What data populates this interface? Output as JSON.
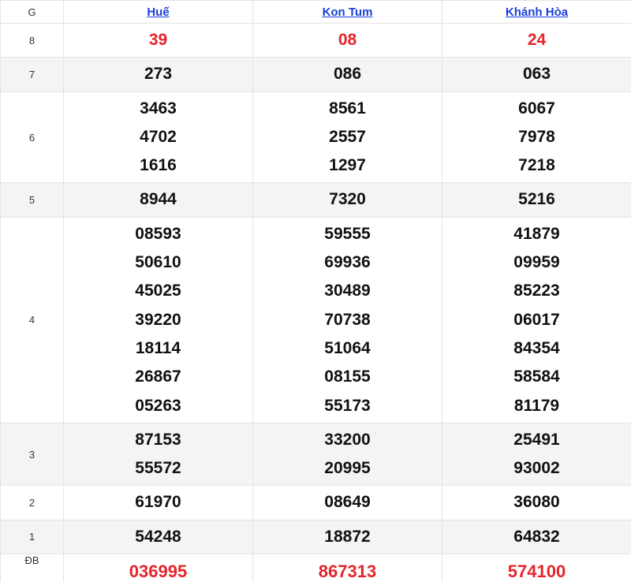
{
  "header": {
    "prize_col": "G",
    "provinces": [
      "Huế",
      "Kon Tum",
      "Khánh Hòa"
    ]
  },
  "rows": [
    {
      "prize": "8",
      "red": true,
      "alt": false,
      "values": [
        [
          "39"
        ],
        [
          "08"
        ],
        [
          "24"
        ]
      ]
    },
    {
      "prize": "7",
      "red": false,
      "alt": true,
      "values": [
        [
          "273"
        ],
        [
          "086"
        ],
        [
          "063"
        ]
      ]
    },
    {
      "prize": "6",
      "red": false,
      "alt": false,
      "values": [
        [
          "3463",
          "4702",
          "1616"
        ],
        [
          "8561",
          "2557",
          "1297"
        ],
        [
          "6067",
          "7978",
          "7218"
        ]
      ]
    },
    {
      "prize": "5",
      "red": false,
      "alt": true,
      "values": [
        [
          "8944"
        ],
        [
          "7320"
        ],
        [
          "5216"
        ]
      ]
    },
    {
      "prize": "4",
      "red": false,
      "alt": false,
      "values": [
        [
          "08593",
          "50610",
          "45025",
          "39220",
          "18114",
          "26867",
          "05263"
        ],
        [
          "59555",
          "69936",
          "30489",
          "70738",
          "51064",
          "08155",
          "55173"
        ],
        [
          "41879",
          "09959",
          "85223",
          "06017",
          "84354",
          "58584",
          "81179"
        ]
      ]
    },
    {
      "prize": "3",
      "red": false,
      "alt": true,
      "values": [
        [
          "87153",
          "55572"
        ],
        [
          "33200",
          "20995"
        ],
        [
          "25491",
          "93002"
        ]
      ]
    },
    {
      "prize": "2",
      "red": false,
      "alt": false,
      "values": [
        [
          "61970"
        ],
        [
          "08649"
        ],
        [
          "36080"
        ]
      ]
    },
    {
      "prize": "1",
      "red": false,
      "alt": true,
      "values": [
        [
          "54248"
        ],
        [
          "18872"
        ],
        [
          "64832"
        ]
      ]
    },
    {
      "prize": "ĐB",
      "red": true,
      "alt": false,
      "values": [
        [
          "036995"
        ],
        [
          "867313"
        ],
        [
          "574100"
        ]
      ]
    }
  ]
}
